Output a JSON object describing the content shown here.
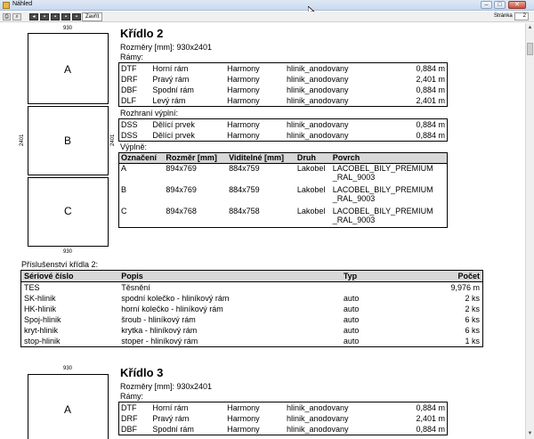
{
  "window": {
    "title": "Náhled",
    "close_label": "Zavřít",
    "page_label": "Stránka",
    "page_value": "2"
  },
  "wing2": {
    "title": "Křídlo 2",
    "dimensions": "Rozměry [mm]: 930x2401",
    "panels": {
      "width_top": "930",
      "width_bottom": "930",
      "height_left": "2401",
      "height_right": "2401",
      "letters": [
        "A",
        "B",
        "C"
      ]
    },
    "frames_label": "Rámy:",
    "frames": [
      {
        "code": "DTF",
        "name": "Horní rám",
        "series": "Harmony",
        "material": "hlinik_anodovany",
        "length": "0,884 m"
      },
      {
        "code": "DRF",
        "name": "Pravý rám",
        "series": "Harmony",
        "material": "hlinik_anodovany",
        "length": "2,401 m"
      },
      {
        "code": "DBF",
        "name": "Spodní rám",
        "series": "Harmony",
        "material": "hlinik_anodovany",
        "length": "0,884 m"
      },
      {
        "code": "DLF",
        "name": "Levý rám",
        "series": "Harmony",
        "material": "hlinik_anodovany",
        "length": "2,401 m"
      }
    ],
    "dividers_label": "Rozhraní výplní:",
    "dividers": [
      {
        "code": "DSS",
        "name": "Dělící prvek",
        "series": "Harmony",
        "material": "hlinik_anodovany",
        "length": "0,884 m"
      },
      {
        "code": "DSS",
        "name": "Dělící prvek",
        "series": "Harmony",
        "material": "hlinik_anodovany",
        "length": "0,884 m"
      }
    ],
    "fills_label": "Výplně:",
    "fills_headers": [
      "Označení",
      "Rozměr [mm]",
      "Viditelné [mm]",
      "Druh",
      "Povrch"
    ],
    "fills": [
      {
        "mark": "A",
        "size": "894x769",
        "visible": "884x759",
        "kind": "Lakobel",
        "surface": "LACOBEL_BILY_PREMIUM _RAL_9003"
      },
      {
        "mark": "B",
        "size": "894x769",
        "visible": "884x759",
        "kind": "Lakobel",
        "surface": "LACOBEL_BILY_PREMIUM _RAL_9003"
      },
      {
        "mark": "C",
        "size": "894x768",
        "visible": "884x758",
        "kind": "Lakobel",
        "surface": "LACOBEL_BILY_PREMIUM _RAL_9003"
      }
    ],
    "accessories_label": "Příslušenství křídla 2:",
    "acc_headers": [
      "Sériové číslo",
      "Popis",
      "Typ",
      "Počet"
    ],
    "accessories": [
      {
        "serial": "TES",
        "desc": "Těsnění",
        "type": "",
        "count": "9,976 m"
      },
      {
        "serial": "SK-hlinik",
        "desc": "spodní kolečko - hliníkový rám",
        "type": "auto",
        "count": "2 ks"
      },
      {
        "serial": "HK-hlinik",
        "desc": "horní kolečko - hliníkový rám",
        "type": "auto",
        "count": "2 ks"
      },
      {
        "serial": "Spoj-hlinik",
        "desc": "šroub - hliníkový rám",
        "type": "auto",
        "count": "6 ks"
      },
      {
        "serial": "kryt-hlinik",
        "desc": "krytka - hliníkový rám",
        "type": "auto",
        "count": "6 ks"
      },
      {
        "serial": "stop-hlinik",
        "desc": "stoper - hliníkový rám",
        "type": "auto",
        "count": "1 ks"
      }
    ]
  },
  "wing3": {
    "title": "Křídlo 3",
    "dimensions": "Rozměry [mm]: 930x2401",
    "panels": {
      "width_top": "930",
      "letters": [
        "A"
      ]
    },
    "frames_label": "Rámy:",
    "frames": [
      {
        "code": "DTF",
        "name": "Horní rám",
        "series": "Harmony",
        "material": "hlinik_anodovany",
        "length": "0,884 m"
      },
      {
        "code": "DRF",
        "name": "Pravý rám",
        "series": "Harmony",
        "material": "hlinik_anodovany",
        "length": "2,401 m"
      },
      {
        "code": "DBF",
        "name": "Spodní rám",
        "series": "Harmony",
        "material": "hlinik_anodovany",
        "length": "0,884 m"
      }
    ]
  }
}
